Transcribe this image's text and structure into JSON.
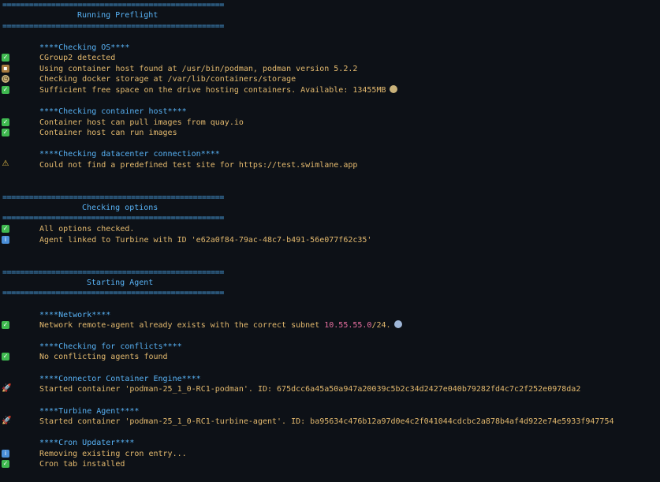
{
  "separator": "==================================================",
  "preflight": {
    "title": "Running Preflight",
    "os": {
      "header": "****Checking OS****",
      "lines": [
        {
          "icon": "check",
          "text": "CGroup2 detected"
        },
        {
          "icon": "box",
          "text": "Using container host found at /usr/bin/podman, podman version 5.2.2"
        },
        {
          "icon": "clock",
          "text": "Checking docker storage at /var/lib/containers/storage"
        },
        {
          "icon": "check",
          "text": "Sufficient free space on the drive hosting containers. Available: 13455MB"
        }
      ]
    },
    "container_host": {
      "header": "****Checking container host****",
      "lines": [
        {
          "icon": "check",
          "text": "Container host can pull images from quay.io"
        },
        {
          "icon": "check",
          "text": "Container host can run images"
        }
      ]
    },
    "datacenter": {
      "header": "****Checking datacenter connection****",
      "lines": [
        {
          "icon": "warning",
          "text": "Could not find a predefined test site for https://test.swimlane.app"
        }
      ]
    }
  },
  "options": {
    "title": "Checking options",
    "lines": [
      {
        "icon": "check",
        "text": "All options checked."
      },
      {
        "icon": "info",
        "text": "Agent linked to Turbine with ID 'e62a0f84-79ac-48c7-b491-56e077f62c35'"
      }
    ]
  },
  "agent": {
    "title": "Starting Agent",
    "network": {
      "header": "****Network****",
      "text_before": "Network remote-agent already exists with the correct subnet ",
      "subnet_ip": "10.55.55.0",
      "text_after": "/24."
    },
    "conflicts": {
      "header": "****Checking for conflicts****",
      "text": "No conflicting agents found"
    },
    "connector": {
      "header": "****Connector Container Engine****",
      "text": "Started container 'podman-25_1_0-RC1-podman'. ID: 675dcc6a45a50a947a20039c5b2c34d2427e040b79282fd4c7c2f252e0978da2"
    },
    "turbine": {
      "header": "****Turbine Agent****",
      "text": "Started container 'podman-25_1_0-RC1-turbine-agent'. ID: ba95634c476b12a97d0e4c2f041044cdcbc2a878b4af4d922e74e5933f947754"
    },
    "cron": {
      "header": "****Cron Updater****",
      "lines": [
        {
          "icon": "info",
          "text": "Removing existing cron entry..."
        },
        {
          "icon": "check",
          "text": "Cron tab installed"
        }
      ]
    }
  }
}
